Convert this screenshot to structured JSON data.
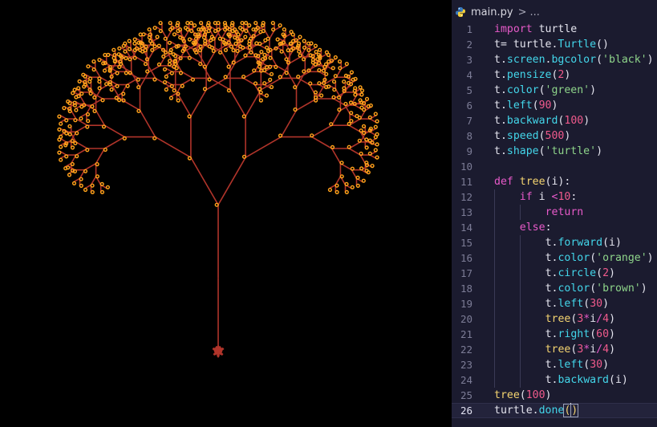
{
  "canvas": {
    "background": "#000000",
    "pen_color": "#b0342a",
    "leaf_color": "#ffa21a",
    "turtle_color": "#b0342a",
    "tree_depth_arg": 100
  },
  "editor": {
    "breadcrumb": {
      "file": "main.py",
      "separator": ">",
      "rest": "..."
    },
    "lines": [
      {
        "n": "1",
        "tokens": [
          [
            "kw",
            "import"
          ],
          [
            "plain",
            " turtle"
          ]
        ]
      },
      {
        "n": "2",
        "tokens": [
          [
            "plain",
            "t= turtle."
          ],
          [
            "fn",
            "Turtle"
          ],
          [
            "plain",
            "()"
          ]
        ]
      },
      {
        "n": "3",
        "tokens": [
          [
            "plain",
            "t."
          ],
          [
            "fn",
            "screen"
          ],
          [
            "plain",
            "."
          ],
          [
            "fn",
            "bgcolor"
          ],
          [
            "plain",
            "("
          ],
          [
            "str",
            "'black'"
          ],
          [
            "plain",
            ")"
          ]
        ]
      },
      {
        "n": "4",
        "tokens": [
          [
            "plain",
            "t."
          ],
          [
            "fn",
            "pensize"
          ],
          [
            "plain",
            "("
          ],
          [
            "num",
            "2"
          ],
          [
            "plain",
            ")"
          ]
        ]
      },
      {
        "n": "5",
        "tokens": [
          [
            "plain",
            "t."
          ],
          [
            "fn",
            "color"
          ],
          [
            "plain",
            "("
          ],
          [
            "str",
            "'green'"
          ],
          [
            "plain",
            ")"
          ]
        ]
      },
      {
        "n": "6",
        "tokens": [
          [
            "plain",
            "t."
          ],
          [
            "fn",
            "left"
          ],
          [
            "plain",
            "("
          ],
          [
            "num",
            "90"
          ],
          [
            "plain",
            ")"
          ]
        ]
      },
      {
        "n": "7",
        "tokens": [
          [
            "plain",
            "t."
          ],
          [
            "fn",
            "backward"
          ],
          [
            "plain",
            "("
          ],
          [
            "num",
            "100"
          ],
          [
            "plain",
            ")"
          ]
        ]
      },
      {
        "n": "8",
        "tokens": [
          [
            "plain",
            "t."
          ],
          [
            "fn",
            "speed"
          ],
          [
            "plain",
            "("
          ],
          [
            "num",
            "500"
          ],
          [
            "plain",
            ")"
          ]
        ]
      },
      {
        "n": "9",
        "tokens": [
          [
            "plain",
            "t."
          ],
          [
            "fn",
            "shape"
          ],
          [
            "plain",
            "("
          ],
          [
            "str",
            "'turtle'"
          ],
          [
            "plain",
            ")"
          ]
        ]
      },
      {
        "n": "10",
        "tokens": []
      },
      {
        "n": "11",
        "tokens": [
          [
            "kw",
            "def"
          ],
          [
            "plain",
            " "
          ],
          [
            "def",
            "tree"
          ],
          [
            "plain",
            "(i):"
          ]
        ]
      },
      {
        "n": "12",
        "indent": 1,
        "tokens": [
          [
            "kw",
            "if"
          ],
          [
            "plain",
            " i "
          ],
          [
            "op",
            "<"
          ],
          [
            "num",
            "10"
          ],
          [
            "plain",
            ":"
          ]
        ]
      },
      {
        "n": "13",
        "indent": 2,
        "tokens": [
          [
            "kw",
            "return"
          ]
        ]
      },
      {
        "n": "14",
        "indent": 1,
        "tokens": [
          [
            "kw",
            "else"
          ],
          [
            "plain",
            ":"
          ]
        ]
      },
      {
        "n": "15",
        "indent": 2,
        "tokens": [
          [
            "plain",
            "t."
          ],
          [
            "fn",
            "forward"
          ],
          [
            "plain",
            "(i)"
          ]
        ]
      },
      {
        "n": "16",
        "indent": 2,
        "tokens": [
          [
            "plain",
            "t."
          ],
          [
            "fn",
            "color"
          ],
          [
            "plain",
            "("
          ],
          [
            "str",
            "'orange'"
          ],
          [
            "plain",
            ")"
          ]
        ]
      },
      {
        "n": "17",
        "indent": 2,
        "tokens": [
          [
            "plain",
            "t."
          ],
          [
            "fn",
            "circle"
          ],
          [
            "plain",
            "("
          ],
          [
            "num",
            "2"
          ],
          [
            "plain",
            ")"
          ]
        ]
      },
      {
        "n": "18",
        "indent": 2,
        "tokens": [
          [
            "plain",
            "t."
          ],
          [
            "fn",
            "color"
          ],
          [
            "plain",
            "("
          ],
          [
            "str",
            "'brown'"
          ],
          [
            "plain",
            ")"
          ]
        ]
      },
      {
        "n": "19",
        "indent": 2,
        "tokens": [
          [
            "plain",
            "t."
          ],
          [
            "fn",
            "left"
          ],
          [
            "plain",
            "("
          ],
          [
            "num",
            "30"
          ],
          [
            "plain",
            ")"
          ]
        ]
      },
      {
        "n": "20",
        "indent": 2,
        "tokens": [
          [
            "def",
            "tree"
          ],
          [
            "plain",
            "("
          ],
          [
            "num",
            "3"
          ],
          [
            "op",
            "*"
          ],
          [
            "plain",
            "i"
          ],
          [
            "op",
            "/"
          ],
          [
            "num",
            "4"
          ],
          [
            "plain",
            ")"
          ]
        ]
      },
      {
        "n": "21",
        "indent": 2,
        "tokens": [
          [
            "plain",
            "t."
          ],
          [
            "fn",
            "right"
          ],
          [
            "plain",
            "("
          ],
          [
            "num",
            "60"
          ],
          [
            "plain",
            ")"
          ]
        ]
      },
      {
        "n": "22",
        "indent": 2,
        "tokens": [
          [
            "def",
            "tree"
          ],
          [
            "plain",
            "("
          ],
          [
            "num",
            "3"
          ],
          [
            "op",
            "*"
          ],
          [
            "plain",
            "i"
          ],
          [
            "op",
            "/"
          ],
          [
            "num",
            "4"
          ],
          [
            "plain",
            ")"
          ]
        ]
      },
      {
        "n": "23",
        "indent": 2,
        "tokens": [
          [
            "plain",
            "t."
          ],
          [
            "fn",
            "left"
          ],
          [
            "plain",
            "("
          ],
          [
            "num",
            "30"
          ],
          [
            "plain",
            ")"
          ]
        ]
      },
      {
        "n": "24",
        "indent": 2,
        "tokens": [
          [
            "plain",
            "t."
          ],
          [
            "fn",
            "backward"
          ],
          [
            "plain",
            "(i)"
          ]
        ]
      },
      {
        "n": "25",
        "tokens": [
          [
            "def",
            "tree"
          ],
          [
            "plain",
            "("
          ],
          [
            "num",
            "100"
          ],
          [
            "plain",
            ")"
          ]
        ]
      },
      {
        "n": "26",
        "active": true,
        "tokens": [
          [
            "plain",
            "turtle."
          ],
          [
            "fn",
            "done"
          ],
          [
            "cursor",
            "("
          ],
          [
            "caret",
            ""
          ],
          [
            "cursor",
            ")"
          ]
        ]
      }
    ]
  }
}
